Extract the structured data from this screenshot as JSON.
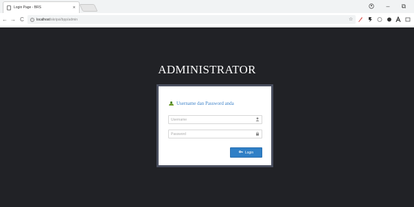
{
  "browser": {
    "tab_title": "Login Page - BRS",
    "tab_close": "×",
    "url_host": "localhost",
    "url_path": "/skripsi/bpp/admin",
    "back_icon": "←",
    "forward_icon": "→",
    "reload_icon": "C",
    "star_icon": "☆",
    "minimize_icon": "–",
    "restore_icon": "⧉"
  },
  "page": {
    "title": "ADMINISTRATOR",
    "panel_heading": "Username dan Password anda",
    "username_placeholder": "Username",
    "password_placeholder": "Password",
    "login_label": "Login",
    "colors": {
      "background": "#212226",
      "accent": "#2f7fc6",
      "heading": "#3e83c9"
    }
  }
}
